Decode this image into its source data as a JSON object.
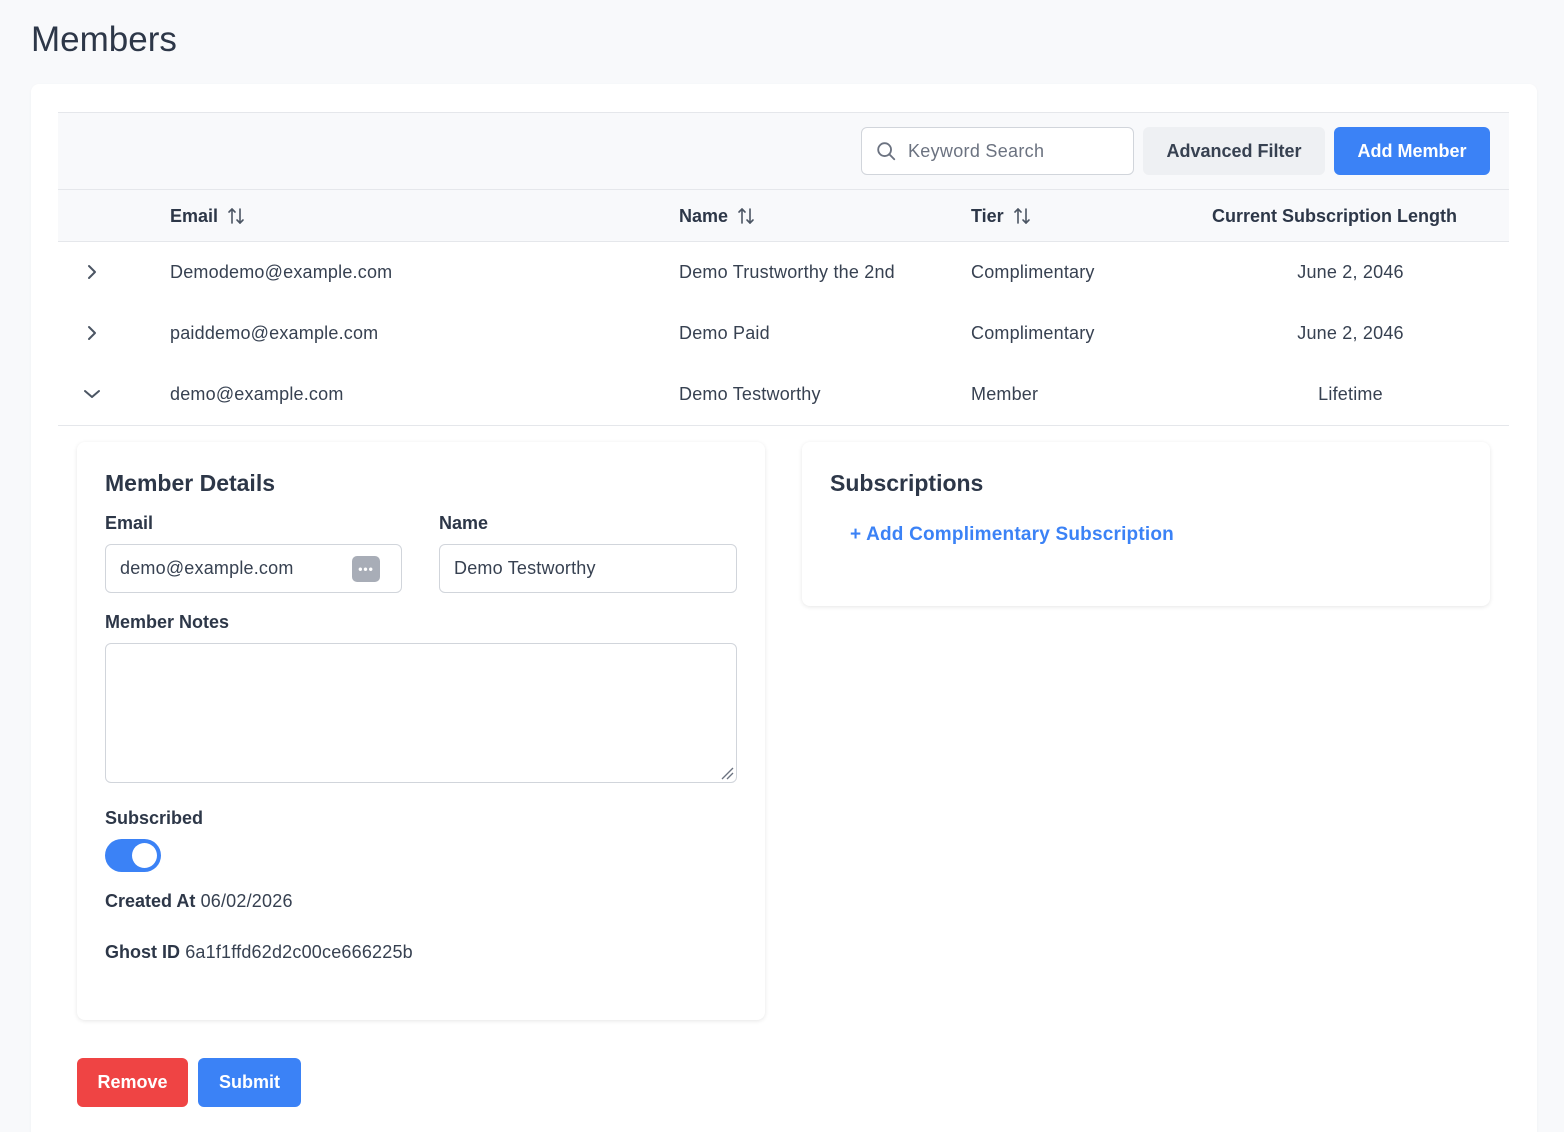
{
  "page": {
    "title": "Members"
  },
  "toolbar": {
    "search_placeholder": "Keyword Search",
    "advanced_filter_label": "Advanced Filter",
    "add_member_label": "Add Member"
  },
  "table": {
    "columns": [
      "Email",
      "Name",
      "Tier",
      "Current Subscription Length"
    ],
    "sortable": [
      true,
      true,
      true,
      false
    ],
    "rows": [
      {
        "email": "Demodemo@example.com",
        "name": "Demo Trustworthy the 2nd",
        "tier": "Complimentary",
        "length": "June 2, 2046",
        "expanded": false
      },
      {
        "email": "paiddemo@example.com",
        "name": "Demo Paid",
        "tier": "Complimentary",
        "length": "June 2, 2046",
        "expanded": false
      },
      {
        "email": "demo@example.com",
        "name": "Demo Testworthy",
        "tier": "Member",
        "length": "Lifetime",
        "expanded": true
      }
    ]
  },
  "details": {
    "title": "Member Details",
    "email_label": "Email",
    "email_value": "demo@example.com",
    "name_label": "Name",
    "name_value": "Demo Testworthy",
    "notes_label": "Member Notes",
    "notes_value": "",
    "subscribed_label": "Subscribed",
    "subscribed": true,
    "created_label": "Created At",
    "created_value": "06/02/2026",
    "ghost_label": "Ghost ID",
    "ghost_value": "6a1f1ffd62d2c00ce666225b"
  },
  "subscriptions": {
    "title": "Subscriptions",
    "add_link": "+ Add Complimentary Subscription"
  },
  "actions": {
    "remove_label": "Remove",
    "submit_label": "Submit"
  },
  "colors": {
    "accent": "#3b82f6",
    "danger": "#ef4444",
    "text": "#2d3748",
    "border": "#e5e7eb"
  },
  "icons": [
    "search-icon",
    "sort-icon",
    "chevron-right-icon",
    "chevron-down-icon",
    "password-manager-icon",
    "resize-handle-icon"
  ]
}
